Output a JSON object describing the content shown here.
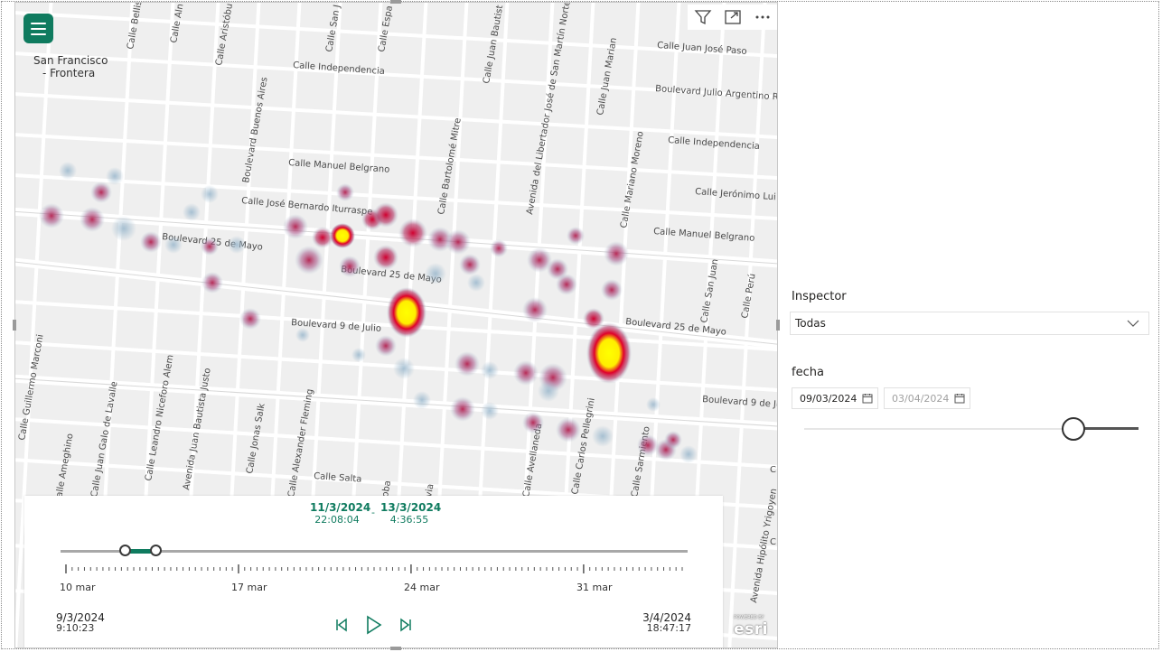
{
  "map": {
    "city_label_line1": "San Francisco",
    "city_label_line2": "- Frontera",
    "streets": {
      "bellis": "Calle Bellis",
      "aln": "Calle Aln",
      "aristobulo": "Calle Aristóbu",
      "san": "Calle San J",
      "espa": "Calle Espa",
      "juan_bautista": "Calle Juan Bautist",
      "libertador": "Avenida del Libertador José de San Martín Norte",
      "juan_mariano": "Calle Juan Marian",
      "juan_jose_paso": "Calle Juan José Paso",
      "boulevard_julio": "Boulevard Julio Argentino R",
      "independencia_1": "Calle Independencia",
      "independencia_2": "Calle Independencia",
      "buenos_aires": "Boulevard Buenos Aires",
      "mitre": "Calle Bartolomé Mitre",
      "mariano_moreno": "Calle Mariano Moreno",
      "belgrano_1": "Calle Manuel Belgrano",
      "belgrano_2": "Calle Manuel Belgrano",
      "jeronimo": "Calle Jerónimo Lui",
      "iturraspe": "Calle José Bernardo Iturraspe",
      "bvd_25_1": "Boulevard 25 de Mayo",
      "bvd_25_2": "Boulevard 25 de Mayo",
      "bvd_25_3": "Boulevard 25 de Mayo",
      "san_juan": "Calle San Juan",
      "peru": "Calle Perú",
      "bvd_9_1": "Boulevard 9 de Julio",
      "bvd_9_2": "Boulevard 9 de Ju",
      "marconi": "Calle Guillermo Marconi",
      "ameghino": "Calle Ameghino",
      "lavalle": "Calle Juan Galo de Lavalle",
      "alem": "Calle Leandro Niceforo Alem",
      "justo": "Avenida Juan Bautista Justo",
      "salk": "Calle Jonas Salk",
      "fleming": "Calle Alexander Fleming",
      "salta": "Calle Salta",
      "oba": "oba",
      "via": "via",
      "avellaneda": "Calle Avellaneda",
      "pellegrini": "Calle Carlos Pellegrini",
      "sarmiento": "Calle Sarmiento",
      "yrigoyen": "Avenida Hipólito Yrigoyen",
      "c_right": "C",
      "c_right_2": "C"
    }
  },
  "time_slider": {
    "range_start_date": "11/3/2024",
    "range_start_time": "22:08:04",
    "range_separator": "-",
    "range_end_date": "13/3/2024",
    "range_end_time": "4:36:55",
    "range_start_fraction": 0.102,
    "range_end_fraction": 0.152,
    "axis_labels": [
      "10 mar",
      "17 mar",
      "24 mar",
      "31 mar"
    ],
    "min_date": "9/3/2024",
    "min_time": "9:10:23",
    "max_date": "3/4/2024",
    "max_time": "18:47:17"
  },
  "esri_logo": "esri",
  "esri_small": "POWERED BY",
  "inspector": {
    "label": "Inspector",
    "selected": "Todas"
  },
  "fecha": {
    "label": "fecha",
    "start": "09/03/2024",
    "end": "03/04/2024",
    "slider_fraction": 0.8
  },
  "colors": {
    "accent": "#0f7b5f",
    "heat_hot": "#ffff00",
    "heat_mid": "#c0003a"
  },
  "icons": [
    "hamburger-menu-icon",
    "filter-icon",
    "focus-mode-icon",
    "more-options-icon",
    "step-back-icon",
    "play-icon",
    "step-forward-icon",
    "chevron-down-icon",
    "calendar-icon"
  ]
}
